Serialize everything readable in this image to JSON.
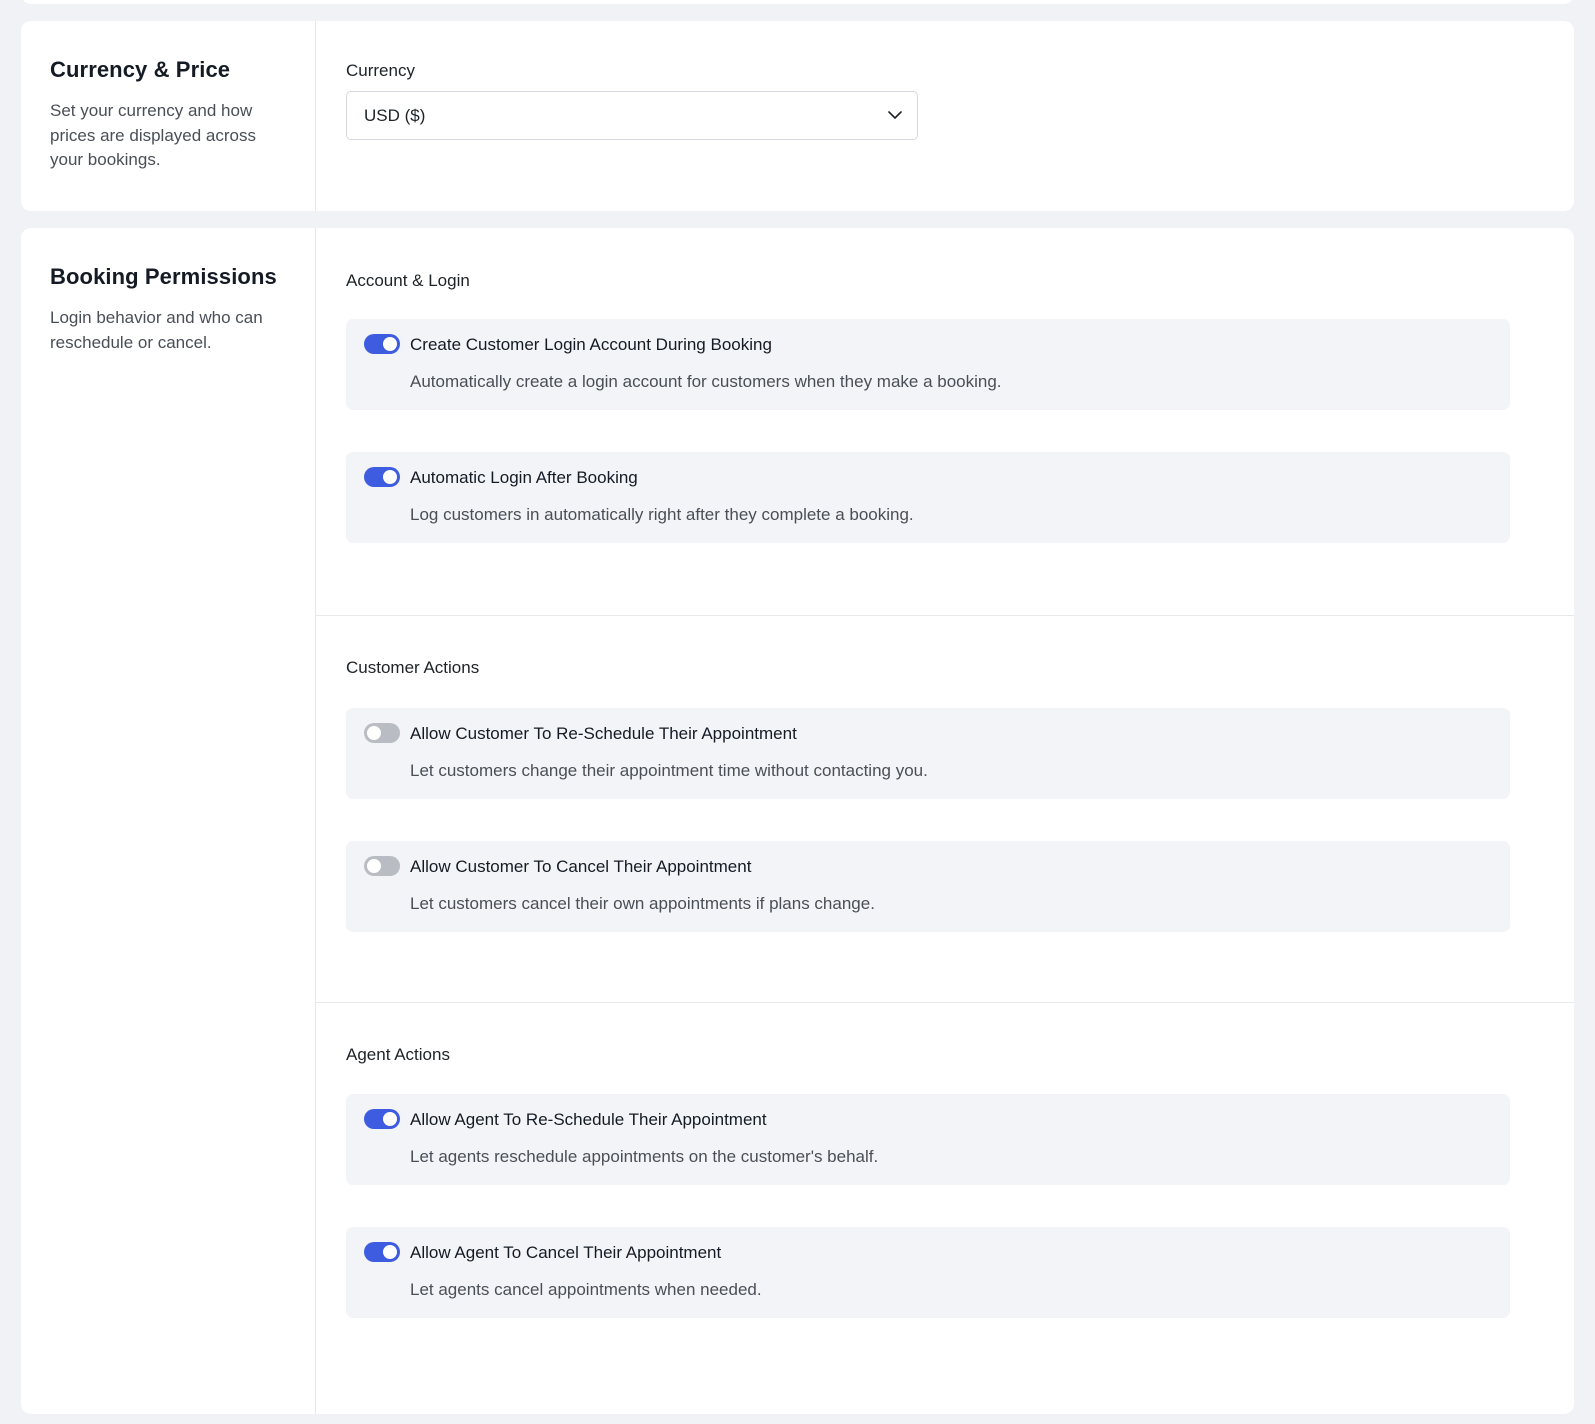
{
  "currency_section": {
    "title": "Currency & Price",
    "description": "Set your currency and how prices are displayed across your bookings.",
    "field_label": "Currency",
    "selected_value": "USD ($)"
  },
  "permissions_section": {
    "title": "Booking Permissions",
    "description": "Login behavior and who can reschedule or cancel.",
    "groups": [
      {
        "title": "Account & Login",
        "options": [
          {
            "label": "Create Customer Login Account During Booking",
            "description": "Automatically create a login account for customers when they make a booking.",
            "enabled": true
          },
          {
            "label": "Automatic Login After Booking",
            "description": "Log customers in automatically right after they complete a booking.",
            "enabled": true
          }
        ]
      },
      {
        "title": "Customer Actions",
        "options": [
          {
            "label": "Allow Customer To Re-Schedule Their Appointment",
            "description": "Let customers change their appointment time without contacting you.",
            "enabled": false
          },
          {
            "label": "Allow Customer To Cancel Their Appointment",
            "description": "Let customers cancel their own appointments if plans change.",
            "enabled": false
          }
        ]
      },
      {
        "title": "Agent Actions",
        "options": [
          {
            "label": "Allow Agent To Re-Schedule Their Appointment",
            "description": "Let agents reschedule appointments on the customer's behalf.",
            "enabled": true
          },
          {
            "label": "Allow Agent To Cancel Their Appointment",
            "description": "Let agents cancel appointments when needed.",
            "enabled": true
          }
        ]
      }
    ]
  },
  "colors": {
    "page_bg": "#f1f2f5",
    "card_bg": "#ffffff",
    "option_bg": "#f3f4f7",
    "toggle_on": "#3d5ce0",
    "toggle_off": "#b9bcc2"
  }
}
